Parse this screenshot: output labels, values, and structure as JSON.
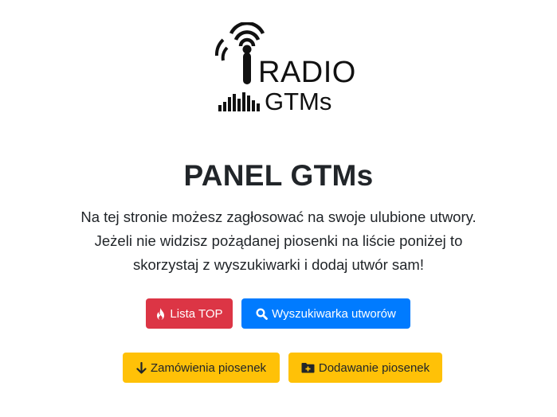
{
  "logo": {
    "line1": "RADIO",
    "line2": "GTMs",
    "icon": "radio-antenna-logo-icon"
  },
  "header": {
    "title": "PANEL GTMs",
    "lead_line1": "Na tej stronie możesz zagłosować na swoje ulubione utwory.",
    "lead_line2": "Jeżeli nie widzisz pożądanej piosenki na liście poniżej to",
    "lead_line3": "skorzystaj z wyszukiwarki i dodaj utwór sam!"
  },
  "buttons": {
    "top_list": {
      "label": "Lista TOP",
      "icon": "fire-icon",
      "color": "#dc3545"
    },
    "search": {
      "label": "Wyszukiwarka utworów",
      "icon": "search-icon",
      "color": "#007bff"
    },
    "requests": {
      "label": "Zamówienia piosenek",
      "icon": "arrow-down-icon",
      "color": "#ffc107"
    },
    "add_song": {
      "label": "Dodawanie piosenek",
      "icon": "folder-plus-icon",
      "color": "#ffc107"
    }
  }
}
